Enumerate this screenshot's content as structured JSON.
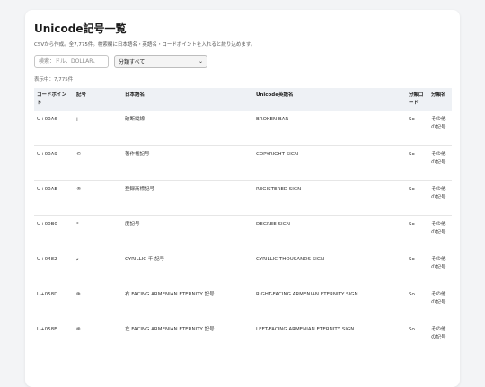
{
  "page": {
    "title": "Unicode記号一覧",
    "description": "CSVから作成。全7,775件。検索欄に日本語名・英語名・コードポイントを入れると絞り込めます。"
  },
  "search": {
    "placeholder": "検索：ドル、DOLLAR、",
    "value": ""
  },
  "filter": {
    "selected": "分類すべて"
  },
  "count_text": "表示中：7,775件",
  "table": {
    "headers": [
      "コードポイント",
      "記号",
      "日本語名",
      "Unicode英語名",
      "分類コード",
      "分類名"
    ],
    "rows": [
      {
        "code": "U+00A6",
        "symbol": "¦",
        "ja": "破断縦線",
        "en": "BROKEN BAR",
        "cat": "So",
        "catname": "その他の記号"
      },
      {
        "code": "U+00A9",
        "symbol": "©",
        "ja": "著作権記号",
        "en": "COPYRIGHT SIGN",
        "cat": "So",
        "catname": "その他の記号"
      },
      {
        "code": "U+00AE",
        "symbol": "®",
        "ja": "登録商標記号",
        "en": "REGISTERED SIGN",
        "cat": "So",
        "catname": "その他の記号"
      },
      {
        "code": "U+00B0",
        "symbol": "°",
        "ja": "度記号",
        "en": "DEGREE SIGN",
        "cat": "So",
        "catname": "その他の記号"
      },
      {
        "code": "U+0482",
        "symbol": "҂",
        "ja": "CYRILLIC 千 記号",
        "en": "CYRILLIC THOUSANDS SIGN",
        "cat": "So",
        "catname": "その他の記号"
      },
      {
        "code": "U+058D",
        "symbol": "֍",
        "ja": "右 FACING ARMENIAN ETERNITY 記号",
        "en": "RIGHT-FACING ARMENIAN ETERNITY SIGN",
        "cat": "So",
        "catname": "その他の記号"
      },
      {
        "code": "U+058E",
        "symbol": "֎",
        "ja": "左 FACING ARMENIAN ETERNITY 記号",
        "en": "LEFT-FACING ARMENIAN ETERNITY SIGN",
        "cat": "So",
        "catname": "その他の記号"
      }
    ]
  }
}
